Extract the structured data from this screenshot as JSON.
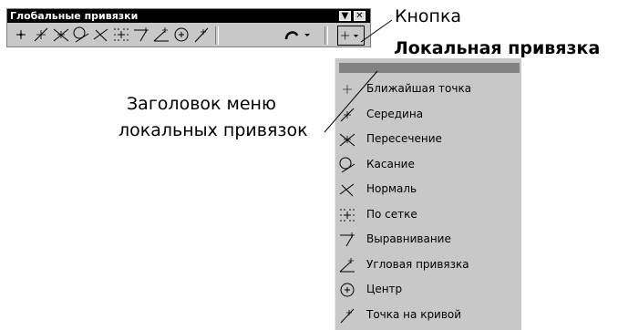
{
  "toolbar": {
    "title": "Глобальные привязки",
    "minimize_symbol": "▼",
    "close_symbol": "✕",
    "icons": [
      "nearest-point-icon",
      "midpoint-icon",
      "intersection-icon",
      "tangent-icon",
      "normal-icon",
      "grid-icon",
      "alignment-icon",
      "angle-snap-icon",
      "center-icon",
      "point-on-curve-icon",
      "curve-snap-icon",
      "local-snap-icon"
    ]
  },
  "callouts": {
    "button_line1": "Кнопка",
    "button_line2": "Локальная привязка",
    "header_line1": "Заголовок меню",
    "header_line2": "локальных привязок"
  },
  "menu": {
    "items": [
      {
        "label": "Ближайшая точка",
        "icon": "nearest-point-icon"
      },
      {
        "label": "Середина",
        "icon": "midpoint-icon"
      },
      {
        "label": "Пересечение",
        "icon": "intersection-icon"
      },
      {
        "label": "Касание",
        "icon": "tangent-icon"
      },
      {
        "label": "Нормаль",
        "icon": "normal-icon"
      },
      {
        "label": "По сетке",
        "icon": "grid-icon"
      },
      {
        "label": "Выравнивание",
        "icon": "alignment-icon"
      },
      {
        "label": "Угловая привязка",
        "icon": "angle-snap-icon"
      },
      {
        "label": "Центр",
        "icon": "center-icon"
      },
      {
        "label": "Точка на кривой",
        "icon": "point-on-curve-icon"
      }
    ]
  }
}
